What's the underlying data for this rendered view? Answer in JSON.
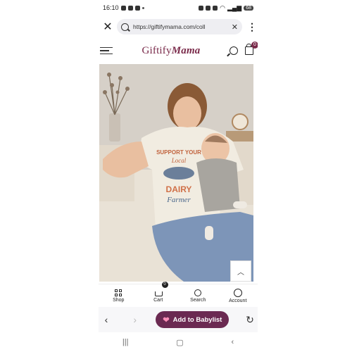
{
  "status": {
    "time": "16:10",
    "battery": "68"
  },
  "browser": {
    "url": "https://giftifymama.com/coll",
    "close_icon": "close-icon",
    "menu_icon": "kebab-icon"
  },
  "site": {
    "logo_part1": "Giftify",
    "logo_part2": "Mama",
    "cart_count": "0"
  },
  "photo": {
    "alt": "Woman wearing Support Your Local Dairy Farmer t-shirt holding baby",
    "shirt_line1": "SUPPORT YOUR",
    "shirt_line2": "Local",
    "shirt_line3": "DAIRY",
    "shirt_line4": "Farmer"
  },
  "tabs": [
    {
      "label": "Shop",
      "icon": "grid-icon"
    },
    {
      "label": "Cart",
      "icon": "cart-icon",
      "badge": "0"
    },
    {
      "label": "Search",
      "icon": "search-icon"
    },
    {
      "label": "Account",
      "icon": "account-icon"
    }
  ],
  "babylist": {
    "label": "Add to Babylist"
  },
  "colors": {
    "brand": "#7a2a4a",
    "babylist": "#6b2a52"
  }
}
